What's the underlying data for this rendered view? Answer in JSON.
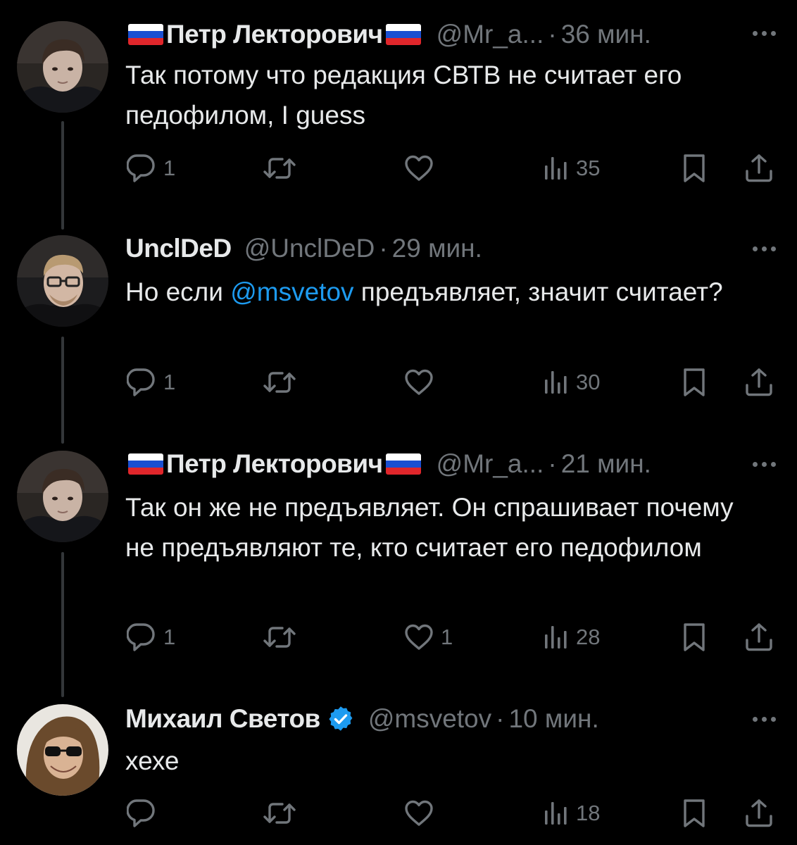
{
  "tweets": [
    {
      "display_name": "Петр Лекторович",
      "handle": "@Mr_a...",
      "separator": "·",
      "time": "36 мин.",
      "text": "Так потому что редакция СВТВ не считает его педофилом, I guess",
      "replies": "1",
      "retweets": "",
      "likes": "",
      "views": "35",
      "flags": true,
      "verified": false
    },
    {
      "display_name": "UnclDeD",
      "handle": "@UnclDeD",
      "separator": "·",
      "time": "29 мин.",
      "text_before": "Но если ",
      "mention": "@msvetov",
      "text_after": " предъявляет, значит считает?",
      "replies": "1",
      "retweets": "",
      "likes": "",
      "views": "30",
      "flags": false,
      "verified": false
    },
    {
      "display_name": "Петр Лекторович",
      "handle": "@Mr_a...",
      "separator": "·",
      "time": "21 мин.",
      "text": "Так он же не предъявляет. Он спрашивает почему не предъявляют те, кто считает его педофилом",
      "replies": "1",
      "retweets": "",
      "likes": "1",
      "views": "28",
      "flags": true,
      "verified": false
    },
    {
      "display_name": "Михаил Светов",
      "handle": "@msvetov",
      "separator": "·",
      "time": "10 мин.",
      "text": "хехе",
      "replies": "",
      "retweets": "",
      "likes": "",
      "views": "18",
      "flags": false,
      "verified": true
    }
  ],
  "icons": {
    "reply": "reply-icon",
    "retweet": "retweet-icon",
    "like": "heart-icon",
    "views": "views-icon",
    "bookmark": "bookmark-icon",
    "share": "share-icon",
    "more": "more-icon",
    "flag": "russian-flag-icon",
    "verified": "verified-badge-icon"
  },
  "colors": {
    "background": "#000000",
    "text": "#e7e9ea",
    "secondary": "#71767b",
    "accent": "#1d9bf0",
    "thread_line": "#333639"
  }
}
